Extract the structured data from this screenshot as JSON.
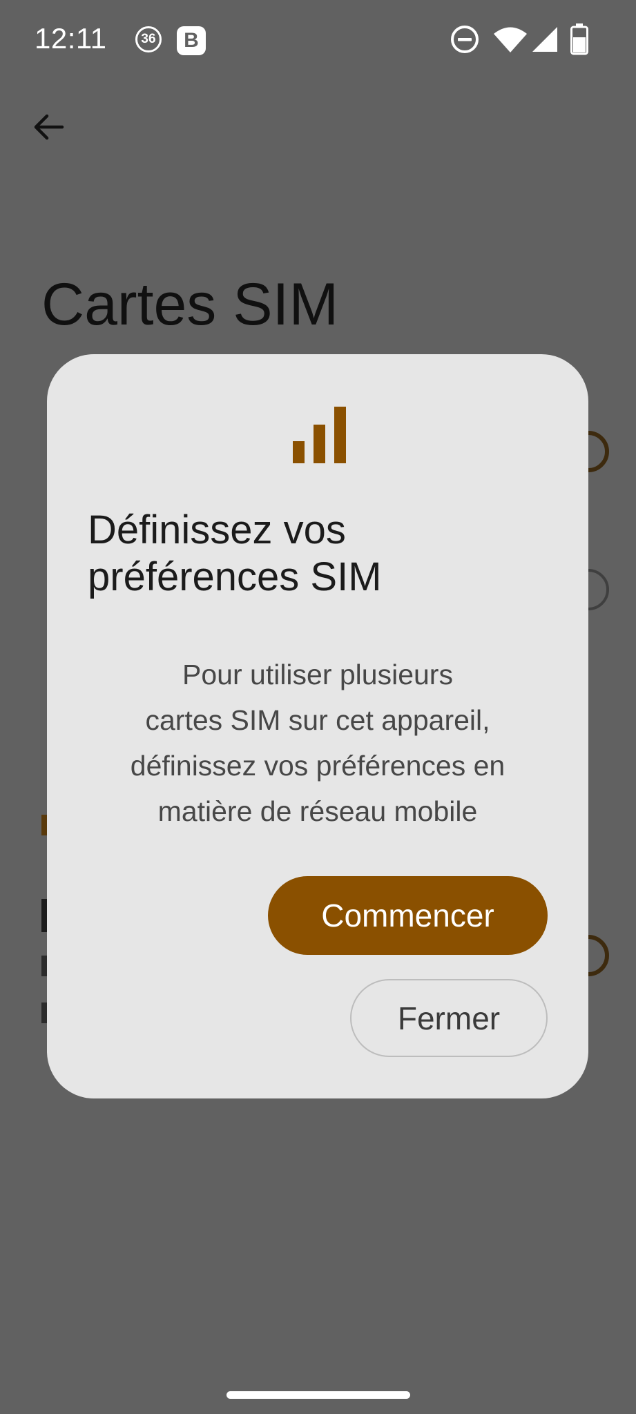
{
  "status_bar": {
    "time": "12:11",
    "badge_number": "36",
    "badge_letter": "B",
    "icons": [
      "do-not-disturb-icon",
      "wifi-icon",
      "cell-signal-icon",
      "battery-icon"
    ]
  },
  "background_screen": {
    "back_icon": "arrow-left-icon",
    "title": "Cartes SIM"
  },
  "dialog": {
    "icon": "signal-bars-icon",
    "title_lines": [
      "Définissez vos",
      "préférences SIM"
    ],
    "body_lines": [
      "Pour utiliser plusieurs",
      "cartes SIM sur cet appareil,",
      "définissez vos préférences en",
      "matière de réseau mobile"
    ],
    "primary_button": "Commencer",
    "secondary_button": "Fermer"
  },
  "colors": {
    "scrim": "#616161",
    "dialog_bg": "#e6e6e6",
    "accent": "#8a5000"
  }
}
